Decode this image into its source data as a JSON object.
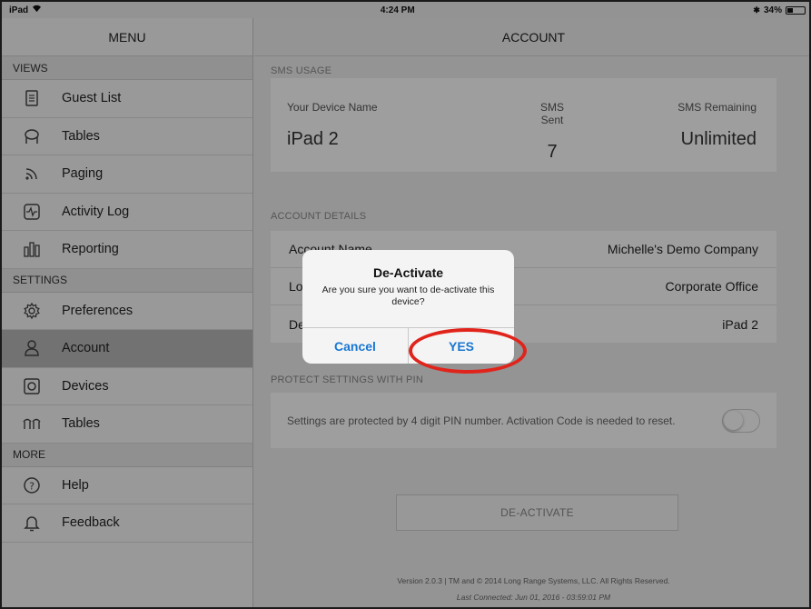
{
  "status": {
    "carrier": "iPad",
    "time": "4:24 PM",
    "battery": "34%",
    "battery_level": 0.34
  },
  "sidebar": {
    "title": "MENU",
    "sections": [
      {
        "header": "VIEWS",
        "items": [
          {
            "label": "Guest List",
            "icon": "list-icon"
          },
          {
            "label": "Tables",
            "icon": "table-icon"
          },
          {
            "label": "Paging",
            "icon": "wifi-icon"
          },
          {
            "label": "Activity Log",
            "icon": "activity-icon"
          },
          {
            "label": "Reporting",
            "icon": "bar-chart-icon"
          }
        ]
      },
      {
        "header": "SETTINGS",
        "items": [
          {
            "label": "Preferences",
            "icon": "gear-icon"
          },
          {
            "label": "Account",
            "icon": "person-icon",
            "active": true
          },
          {
            "label": "Devices",
            "icon": "device-icon"
          },
          {
            "label": "Tables",
            "icon": "tables-icon"
          }
        ]
      },
      {
        "header": "MORE",
        "items": [
          {
            "label": "Help",
            "icon": "help-icon"
          },
          {
            "label": "Feedback",
            "icon": "bell-icon"
          }
        ]
      }
    ]
  },
  "main": {
    "title": "ACCOUNT",
    "sms": {
      "section_label": "SMS USAGE",
      "device_name_label": "Your Device Name",
      "device_name": "iPad 2",
      "sent_label": "SMS Sent",
      "sent": "7",
      "remaining_label": "SMS Remaining",
      "remaining": "Unlimited"
    },
    "details": {
      "section_label": "ACCOUNT DETAILS",
      "rows": [
        {
          "label": "Account Name",
          "value": "Michelle's Demo Company"
        },
        {
          "label": "Location",
          "value": "Corporate Office"
        },
        {
          "label": "Device",
          "value": "iPad 2"
        }
      ]
    },
    "pin": {
      "section_label": "PROTECT SETTINGS WITH PIN",
      "text": "Settings are protected by 4 digit PIN number. Activation Code is needed to reset.",
      "enabled": false
    },
    "deactivate_label": "DE-ACTIVATE",
    "footer_version": "Version 2.0.3 | TM and © 2014 Long Range Systems, LLC. All Rights Reserved.",
    "footer_connected": "Last Connected: Jun 01, 2016 - 03:59:01 PM"
  },
  "dialog": {
    "title": "De-Activate",
    "message": "Are you sure you want to de-activate this device?",
    "cancel_label": "Cancel",
    "confirm_label": "YES"
  },
  "colors": {
    "accent": "#1877d2",
    "highlight": "#e0241b",
    "active_row": "#b9b9b9"
  }
}
